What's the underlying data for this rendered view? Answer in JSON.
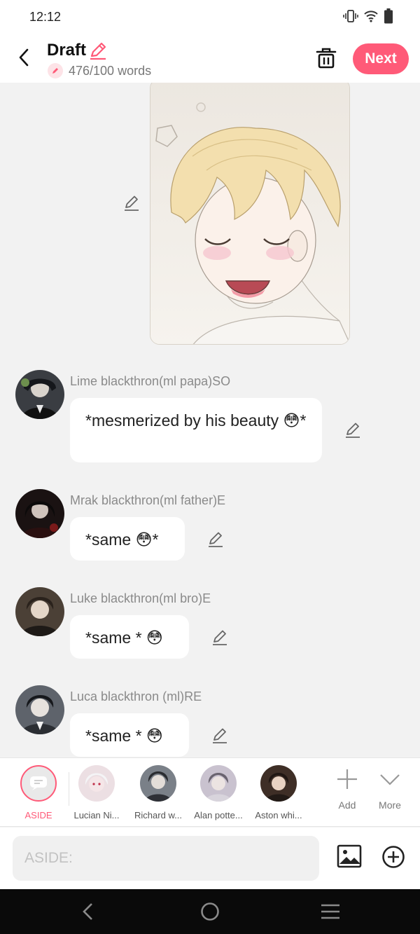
{
  "status_bar": {
    "time": "12:12"
  },
  "header": {
    "title": "Draft",
    "word_count": "476/100 words",
    "next_label": "Next"
  },
  "messages": [
    {
      "name": "Lime blackthron(ml papa)SO",
      "text": "*mesmerized by his beauty 😳*"
    },
    {
      "name": "Mrak blackthron(ml father)E",
      "text": "*same 😳*"
    },
    {
      "name": "Luke blackthron(ml bro)E",
      "text": "*same * 😳"
    },
    {
      "name": "Luca blackthron (ml)RE",
      "text": "*same * 😳"
    }
  ],
  "characters": {
    "aside_label": "ASIDE",
    "items": [
      "Lucian Ni...",
      "Richard w...",
      "Alan potte...",
      "Aston whi..."
    ],
    "add_label": "Add",
    "more_label": "More"
  },
  "composer": {
    "placeholder": "ASIDE:"
  },
  "colors": {
    "accent": "#ff5a78",
    "background": "#f2f2f2"
  }
}
